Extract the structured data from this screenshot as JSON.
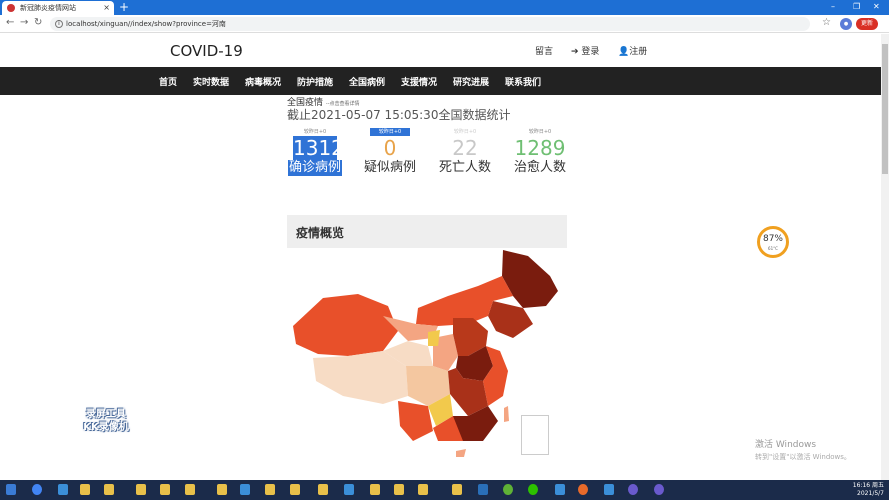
{
  "browser": {
    "tab_title": "新冠肺炎疫情网站",
    "tab_close": "×",
    "new_tab": "+",
    "url": "localhost/xinguan//index/show?province=河南",
    "profile": "更新",
    "update_label": "更新",
    "win_min": "–",
    "win_max": "❐",
    "win_close": "✕"
  },
  "header": {
    "brand": "COVID-19",
    "links": {
      "message": "留言",
      "login": "登录",
      "register": "注册"
    }
  },
  "nav": [
    "首页",
    "实时数据",
    "病毒概况",
    "防护措施",
    "全国病例",
    "支援情况",
    "研究进展",
    "联系我们"
  ],
  "summary": {
    "title": "全国疫情",
    "hint": "--点击查看详情",
    "timestamp": "截止2021-05-07 15:05:30全国数据统计"
  },
  "stats": [
    {
      "delta": "较昨日+0",
      "value": "1312",
      "label": "确诊病例",
      "color": "#ffffff"
    },
    {
      "delta": "较昨日+0",
      "value": "0",
      "label": "疑似病例",
      "color": "#e8a34a"
    },
    {
      "delta": "较昨日+0",
      "value": "22",
      "label": "死亡人数",
      "color": "#c8c8c8"
    },
    {
      "delta": "较昨日+0",
      "value": "1289",
      "label": "治愈人数",
      "color": "#6fbf73"
    }
  ],
  "overview": {
    "title": "疫情概览"
  },
  "gauge": {
    "percent": "87%",
    "temp": "61°C"
  },
  "watermark": {
    "line1": "录屏工具",
    "line2": "KK录像机"
  },
  "activation": {
    "title": "激活 Windows",
    "subtitle": "转到\"设置\"以激活 Windows。"
  },
  "taskbar": {
    "time": "16:16 周五",
    "date": "2021/5/7"
  },
  "map_colors": {
    "dark": "#7a1c0e",
    "mid": "#e8502a",
    "light": "#f4a582",
    "pale": "#f7dcc5",
    "yellow": "#f2c94c"
  }
}
